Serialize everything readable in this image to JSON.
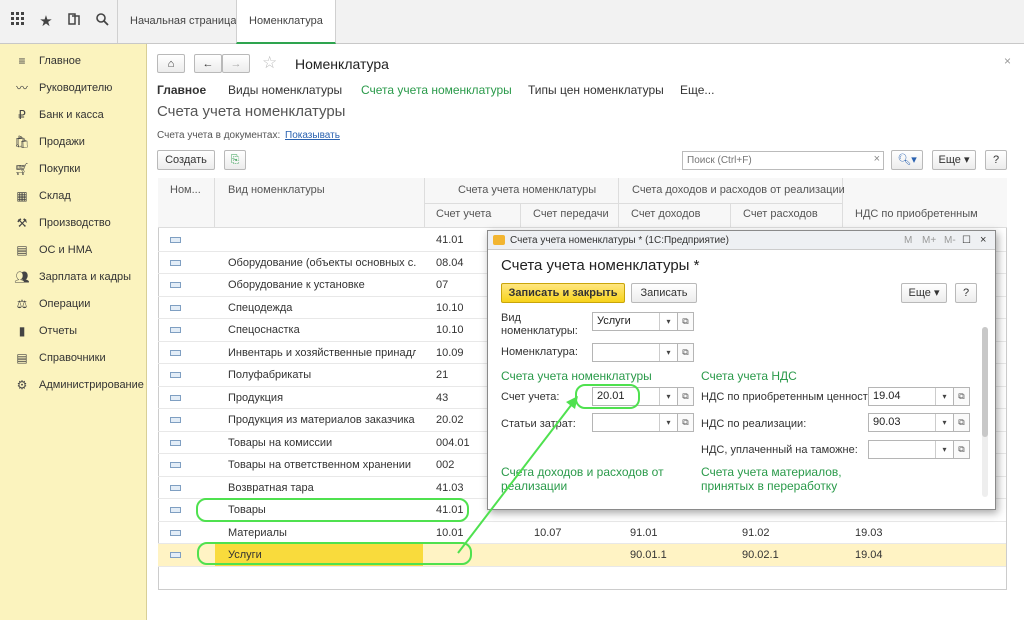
{
  "topbar": {
    "icons": [
      "apps-grid-icon",
      "star-icon",
      "history-icon",
      "search-icon"
    ],
    "tabs": [
      {
        "label": "Начальная страница"
      },
      {
        "label": "Номенклатура"
      }
    ]
  },
  "sidebar": {
    "items": [
      {
        "label": "Главное",
        "icon": "menu-icon"
      },
      {
        "label": "Руководителю",
        "icon": "trend-icon"
      },
      {
        "label": "Банк и касса",
        "icon": "bank-icon"
      },
      {
        "label": "Продажи",
        "icon": "sales-icon"
      },
      {
        "label": "Покупки",
        "icon": "cart-icon"
      },
      {
        "label": "Склад",
        "icon": "warehouse-icon"
      },
      {
        "label": "Производство",
        "icon": "factory-icon"
      },
      {
        "label": "ОС и НМА",
        "icon": "assets-icon"
      },
      {
        "label": "Зарплата и кадры",
        "icon": "people-icon"
      },
      {
        "label": "Операции",
        "icon": "operations-icon"
      },
      {
        "label": "Отчеты",
        "icon": "reports-icon"
      },
      {
        "label": "Справочники",
        "icon": "books-icon"
      },
      {
        "label": "Администрирование",
        "icon": "gear-icon"
      }
    ]
  },
  "header": {
    "title": "Номенклатура",
    "nav_tabs": [
      "Главное",
      "Виды номенклатуры",
      "Счета учета номенклатуры",
      "Типы цен номенклатуры",
      "Еще..."
    ],
    "section_title": "Счета учета номенклатуры",
    "docs_label": "Счета учета в документах:",
    "docs_link": "Показывать",
    "create_label": "Создать",
    "search_placeholder": "Поиск (Ctrl+F)",
    "more_label": "Еще",
    "help_label": "?"
  },
  "table": {
    "group_headers": [
      "Счета учета номенклатуры",
      "Счета доходов и расходов от реализации"
    ],
    "columns": [
      "Ном...",
      "Вид номенклатуры",
      "Счет учета",
      "Счет передачи",
      "Счет доходов",
      "Счет расходов",
      "НДС по приобретенным"
    ],
    "rows": [
      {
        "kind": "",
        "acc": "41.01",
        "transfer": "",
        "income": "",
        "expense": "",
        "vat": ""
      },
      {
        "kind": "Оборудование (объекты основных с...",
        "acc": "08.04",
        "transfer": "",
        "income": "",
        "expense": "",
        "vat": ""
      },
      {
        "kind": "Оборудование к установке",
        "acc": "07",
        "transfer": "",
        "income": "",
        "expense": "",
        "vat": ""
      },
      {
        "kind": "Спецодежда",
        "acc": "10.10",
        "transfer": "",
        "income": "",
        "expense": "",
        "vat": ""
      },
      {
        "kind": "Спецоснастка",
        "acc": "10.10",
        "transfer": "",
        "income": "",
        "expense": "",
        "vat": ""
      },
      {
        "kind": "Инвентарь и хозяйственные принадл...",
        "acc": "10.09",
        "transfer": "",
        "income": "",
        "expense": "",
        "vat": ""
      },
      {
        "kind": "Полуфабрикаты",
        "acc": "21",
        "transfer": "",
        "income": "",
        "expense": "",
        "vat": ""
      },
      {
        "kind": "Продукция",
        "acc": "43",
        "transfer": "",
        "income": "",
        "expense": "",
        "vat": ""
      },
      {
        "kind": "Продукция из материалов заказчика",
        "acc": "20.02",
        "transfer": "",
        "income": "",
        "expense": "",
        "vat": ""
      },
      {
        "kind": "Товары на комиссии",
        "acc": "004.01",
        "transfer": "",
        "income": "",
        "expense": "",
        "vat": ""
      },
      {
        "kind": "Товары на ответственном хранении",
        "acc": "002",
        "transfer": "",
        "income": "",
        "expense": "",
        "vat": ""
      },
      {
        "kind": "Возвратная тара",
        "acc": "41.03",
        "transfer": "",
        "income": "",
        "expense": "",
        "vat": ""
      },
      {
        "kind": "Товары",
        "acc": "41.01",
        "transfer": "",
        "income": "",
        "expense": "",
        "vat": ""
      },
      {
        "kind": "Материалы",
        "acc": "10.01",
        "transfer": "10.07",
        "income": "91.01",
        "expense": "91.02",
        "vat": "19.03"
      },
      {
        "kind": "Услуги",
        "acc": "",
        "transfer": "",
        "income": "90.01.1",
        "expense": "90.02.1",
        "vat": "19.04"
      }
    ]
  },
  "dialog": {
    "window_title": "Счета учета номенклатуры * (1С:Предприятие)",
    "title_icons": [
      "M",
      "M+",
      "M-"
    ],
    "heading": "Счета учета номенклатуры *",
    "save_close_label": "Записать и закрыть",
    "save_label": "Записать",
    "more_label": "Еще",
    "help_label": "?",
    "kind_label": "Вид номенклатуры:",
    "kind_value": "Услуги",
    "item_label": "Номенклатура:",
    "item_value": "",
    "section_accounts": "Счета учета номенклатуры",
    "section_vat": "Счета учета НДС",
    "account_label": "Счет учета:",
    "account_value": "20.01",
    "cost_label": "Статьи затрат:",
    "cost_value": "",
    "vat_purchase_label": "НДС по приобретенным ценностям:",
    "vat_purchase_value": "19.04",
    "vat_sales_label": "НДС по реализации:",
    "vat_sales_value": "90.03",
    "vat_customs_label": "НДС, уплаченный на таможне:",
    "vat_customs_value": "",
    "section_income": "Счета доходов и расходов от реализации",
    "section_materials": "Счета учета материалов, принятых в переработку"
  },
  "colors": {
    "sidebar_bg": "#fbf3be",
    "accent_green": "#2a9a4a",
    "highlight": "#4fe14f",
    "selected_row": "#fff3c4",
    "primary_button": "#f7d31b"
  }
}
